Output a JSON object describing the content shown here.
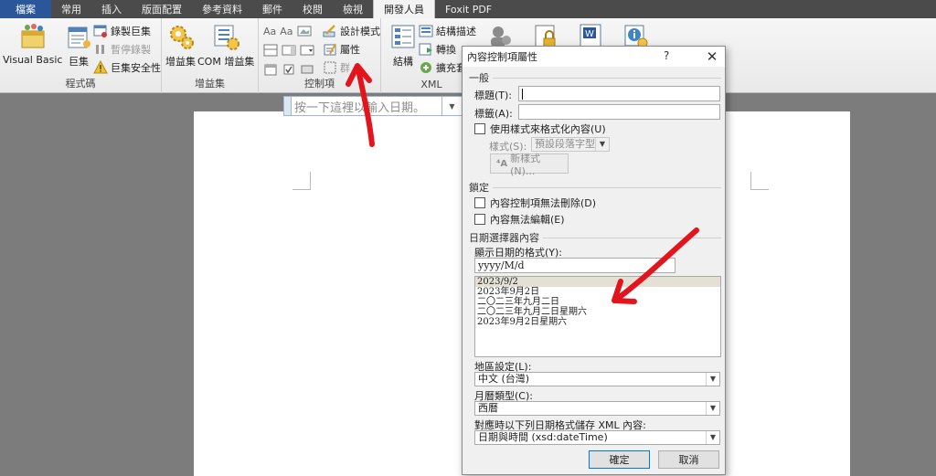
{
  "tabs": [
    "檔案",
    "常用",
    "插入",
    "版面配置",
    "參考資料",
    "郵件",
    "校閱",
    "檢視",
    "開發人員",
    "Foxit PDF"
  ],
  "active_tab": "開發人員",
  "ribbon": {
    "code_group": {
      "label": "程式碼",
      "visual_basic": "Visual Basic",
      "macros": "巨集",
      "record_macro": "錄製巨集",
      "pause_recording": "暫停錄製",
      "macro_security": "巨集安全性"
    },
    "addins_group": {
      "label": "增益集",
      "addins": "增益集",
      "com_addins": "COM 增益集"
    },
    "controls_group": {
      "label": "控制項",
      "design_mode": "設計模式",
      "properties": "屬性",
      "group": "群"
    },
    "xml_group": {
      "label": "XML",
      "structure": "結構",
      "structure_desc": "結構描述",
      "transform": "轉換",
      "expansion": "擴充套"
    }
  },
  "document": {
    "date_placeholder": "按一下這裡以輸入日期。"
  },
  "dialog": {
    "title": "內容控制項屬性",
    "help": "?",
    "close": "✕",
    "general": "一般",
    "title_label": "標題(T):",
    "tag_label": "標籤(A):",
    "use_style": "使用樣式來格式化內容(U)",
    "style_label": "樣式(S):",
    "style_value": "預設段落字型",
    "new_style": "新樣式(N)...",
    "locking": "鎖定",
    "cannot_delete": "內容控制項無法刪除(D)",
    "cannot_edit": "內容無法編輯(E)",
    "date_picker": "日期選擇器內容",
    "display_format_label": "顯示日期的格式(Y):",
    "display_format_value": "yyyy/M/d",
    "formats": [
      "2023/9/2",
      "2023年9月2日",
      "二〇二三年九月二日",
      "二〇二三年九月二日星期六",
      "2023年9月2日星期六"
    ],
    "locale_label": "地區設定(L):",
    "locale_value": "中文 (台灣)",
    "calendar_label": "月曆類型(C):",
    "calendar_value": "西曆",
    "xml_label": "對應時以下列日期格式儲存 XML 內容:",
    "xml_value": "日期與時間 (xsd:dateTime)",
    "ok": "確定",
    "cancel": "取消"
  },
  "colors": {
    "file_tab": "#2b579a",
    "annotation_arrow": "#e3141b"
  }
}
